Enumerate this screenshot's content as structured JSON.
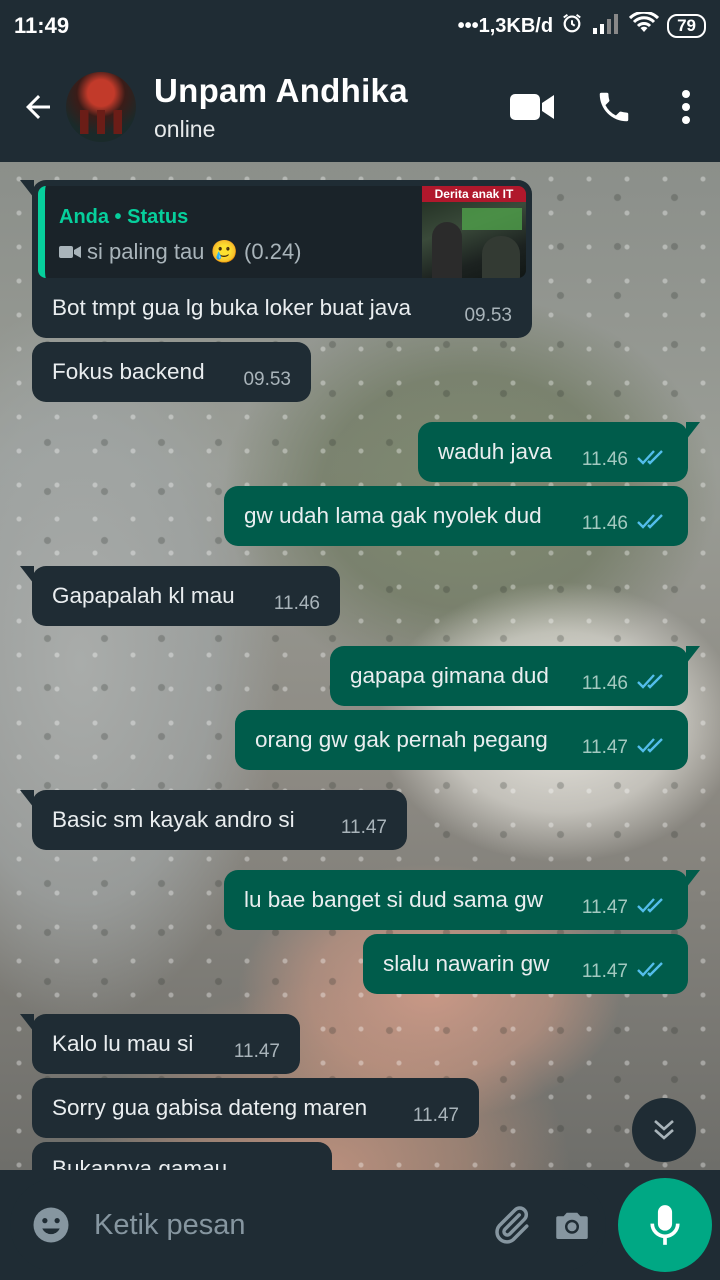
{
  "status_bar": {
    "time": "11:49",
    "network_speed": "•••1,3KB/d",
    "battery": "79"
  },
  "header": {
    "contact_name": "Unpam Andhika",
    "contact_status": "online"
  },
  "reply_message": {
    "quote_author": "Anda • Status",
    "quote_text": "si paling tau 🥲 (0.24)",
    "thumbnail_label": "Derita anak IT",
    "text": "Bot tmpt gua lg buka loker buat java",
    "time": "09.53"
  },
  "messages": [
    {
      "text": "Fokus backend",
      "time": "09.53",
      "dir": "in"
    },
    {
      "text": "waduh java",
      "time": "11.46",
      "dir": "out"
    },
    {
      "text": "gw udah lama gak nyolek dud",
      "time": "11.46",
      "dir": "out"
    },
    {
      "text": "Gapapalah kl mau",
      "time": "11.46",
      "dir": "in"
    },
    {
      "text": "gapapa gimana dud",
      "time": "11.46",
      "dir": "out"
    },
    {
      "text": "orang gw gak pernah pegang",
      "time": "11.47",
      "dir": "out"
    },
    {
      "text": "Basic sm kayak andro si",
      "time": "11.47",
      "dir": "in"
    },
    {
      "text": "lu bae banget si dud sama gw",
      "time": "11.47",
      "dir": "out"
    },
    {
      "text": "slalu nawarin gw",
      "time": "11.47",
      "dir": "out"
    },
    {
      "text": "Kalo lu mau si",
      "time": "11.47",
      "dir": "in"
    },
    {
      "text": "Sorry gua gabisa dateng maren",
      "time": "11.47",
      "dir": "in"
    },
    {
      "text": "Bukannya gamau",
      "time": "",
      "dir": "in"
    }
  ],
  "composer": {
    "placeholder": "Ketik pesan"
  },
  "colors": {
    "bar": "#1f2c34",
    "outgoing": "#005c4b",
    "incoming": "#1f2c34",
    "accent": "#00a884",
    "ticks": "#53bdeb"
  }
}
